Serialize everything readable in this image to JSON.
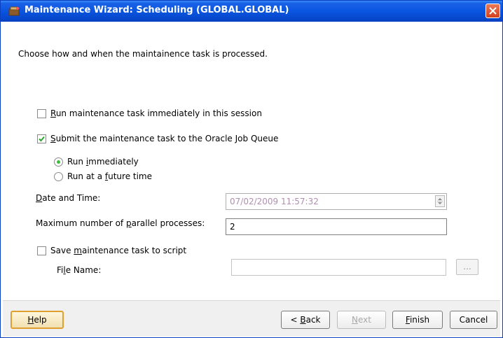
{
  "window": {
    "title": "Maintenance Wizard: Scheduling (GLOBAL.GLOBAL)"
  },
  "intro": "Choose how and when the maintainence task is processed.",
  "options": {
    "run_immediately_session": {
      "label_prefix": "",
      "label_mnemonic": "R",
      "label_rest": "un maintenance task immediately in this session",
      "checked": false
    },
    "submit_job_queue": {
      "label_mnemonic": "S",
      "label_rest": "ubmit the maintenance task to the Oracle Job Queue",
      "checked": true
    },
    "radio_immediately": {
      "label_prefix": "Run ",
      "label_mnemonic": "i",
      "label_rest": "mmediately",
      "selected": true
    },
    "radio_future": {
      "label_prefix": "Run at a ",
      "label_mnemonic": "f",
      "label_rest": "uture time",
      "selected": false
    }
  },
  "date_time": {
    "label_mnemonic": "D",
    "label_rest": "ate and Time:",
    "value": "07/02/2009 11:57:32"
  },
  "parallel": {
    "label_prefix": "Maximum number of ",
    "label_mnemonic": "p",
    "label_rest": "arallel processes:",
    "value": "2"
  },
  "save_script": {
    "label_prefix": "Save ",
    "label_mnemonic": "m",
    "label_rest": "aintenance task to script",
    "checked": false
  },
  "file_name": {
    "label_prefix": "Fi",
    "label_mnemonic": "l",
    "label_rest": "e Name:",
    "value": "",
    "browse_label": "..."
  },
  "footer": {
    "help_mnemonic": "H",
    "help_rest": "elp",
    "back_prefix": "< ",
    "back_mnemonic": "B",
    "back_rest": "ack",
    "next_mnemonic": "N",
    "next_rest": "ext",
    "finish_mnemonic": "F",
    "finish_rest": "inish",
    "cancel_label": "Cancel"
  },
  "colors": {
    "titlebar": "#0a55e0",
    "check_green": "#2fa82f",
    "help_border": "#e0a030"
  }
}
